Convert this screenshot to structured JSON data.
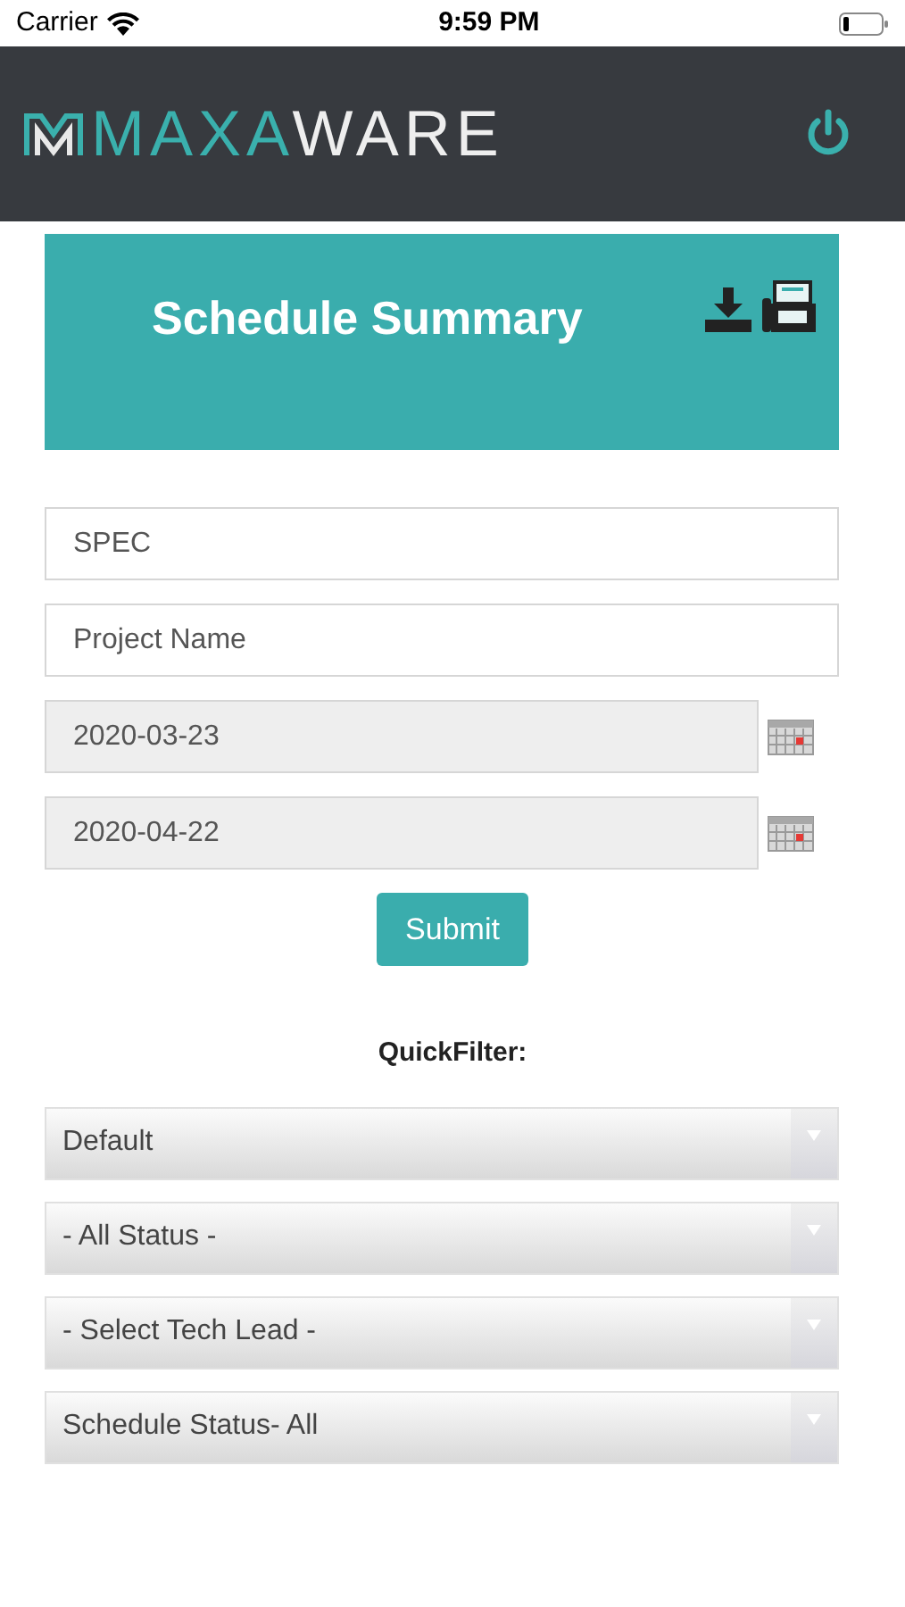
{
  "status_bar": {
    "carrier": "Carrier",
    "time": "9:59 PM"
  },
  "header": {
    "logo_accent": "MAXA",
    "logo_rest": "WARE"
  },
  "summary_card": {
    "title": "Schedule Summary"
  },
  "fields": [
    {
      "kind": "text",
      "placeholder": "SPEC"
    },
    {
      "kind": "text",
      "placeholder": "Project Name"
    },
    {
      "kind": "date",
      "value": "2020-03-23"
    },
    {
      "kind": "date",
      "value": "2020-04-22"
    }
  ],
  "submit_button": "Submit",
  "quick_filter": {
    "label": "QuickFilter:",
    "selects": [
      {
        "value": "Default"
      },
      {
        "value": "- All Status -"
      },
      {
        "value": "- Select Tech Lead -"
      },
      {
        "value": "Schedule Status- All"
      }
    ]
  }
}
